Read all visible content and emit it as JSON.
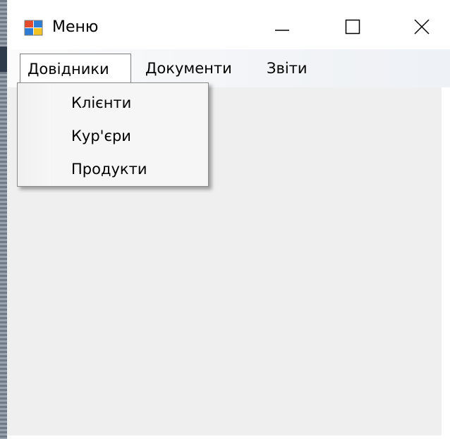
{
  "window": {
    "title": "Меню",
    "controls": {
      "minimize_icon": "minimize-icon",
      "maximize_icon": "maximize-icon",
      "close_icon": "close-icon"
    }
  },
  "menubar": {
    "items": [
      {
        "label": "Довідники",
        "open": true
      },
      {
        "label": "Документи"
      },
      {
        "label": "Звіти"
      }
    ]
  },
  "dropdown": {
    "items": [
      {
        "label": "Клієнти"
      },
      {
        "label": "Кур'єри"
      },
      {
        "label": "Продукти"
      }
    ]
  },
  "colors": {
    "client_area": "#efefef",
    "menubar": "#f2f4f7",
    "dropdown_bg": "#f6f6f6",
    "icon_red": "#e64b2b",
    "icon_yellow": "#f3c323",
    "icon_blue": "#2d7cd6"
  }
}
